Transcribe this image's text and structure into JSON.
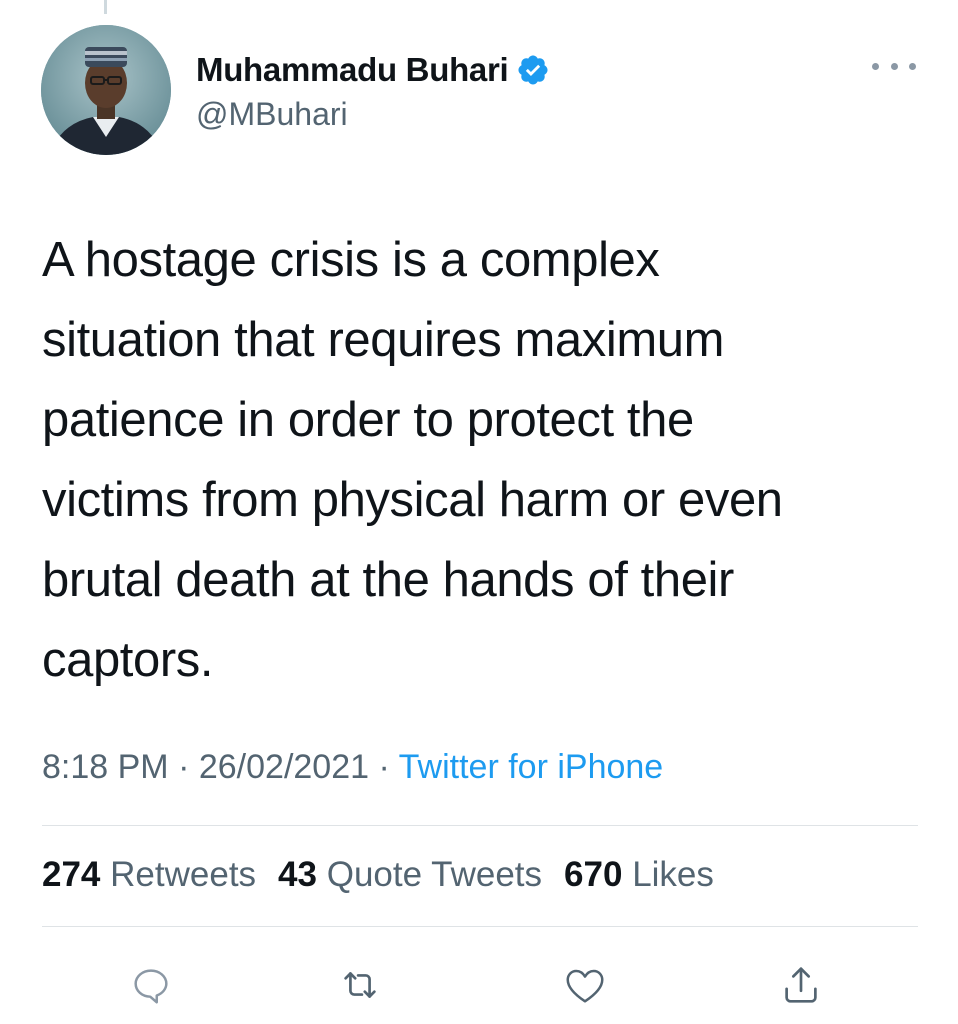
{
  "author": {
    "display_name": "Muhammadu Buhari",
    "handle": "@MBuhari",
    "verified": true
  },
  "tweet": {
    "text": "A hostage crisis is a complex\nsituation that requires maximum\npatience in order to protect the\nvictims from physical harm or even\nbrutal death at the hands of their\ncaptors.",
    "time": "8:18 PM",
    "separator": "·",
    "date": "26/02/2021",
    "source": "Twitter for iPhone"
  },
  "stats": {
    "retweets_count": "274",
    "retweets_label": "Retweets",
    "quotes_count": "43",
    "quotes_label": "Quote Tweets",
    "likes_count": "670",
    "likes_label": "Likes"
  },
  "icons": {
    "verified": "verified-badge-icon",
    "more": "more-options-icon",
    "reply": "reply-icon",
    "retweet": "retweet-icon",
    "like": "like-heart-icon",
    "share": "share-icon"
  },
  "colors": {
    "accent": "#1d9bf0",
    "text_primary": "#0f1419",
    "text_secondary": "#536471",
    "divider": "#dfe3e6"
  }
}
